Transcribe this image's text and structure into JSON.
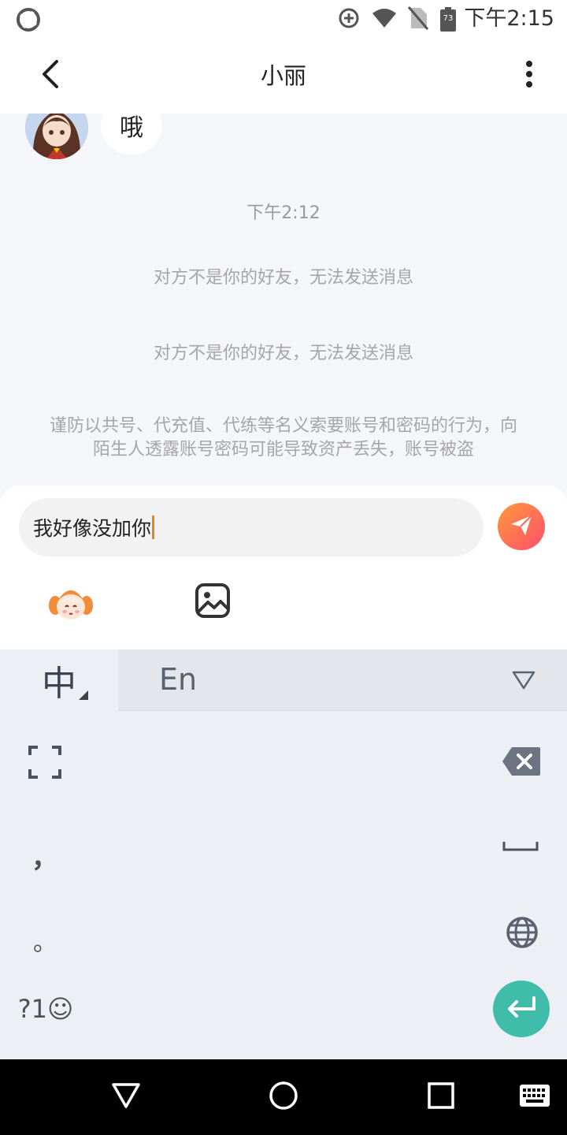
{
  "status_bar": {
    "time": "下午2:15",
    "battery": "73",
    "icons": [
      "app-logo-icon",
      "data-saver-icon",
      "wifi-icon",
      "no-sim-icon",
      "battery-icon"
    ]
  },
  "header": {
    "title": "小丽",
    "back_icon": "chevron-left-icon",
    "more_icon": "more-vertical-icon"
  },
  "chat": {
    "messages": [
      {
        "sender": "小丽",
        "text": "哦"
      }
    ],
    "time_label": "下午2:12",
    "system_notes": [
      "对方不是你的好友，无法发送消息",
      "对方不是你的好友，无法发送消息"
    ],
    "warning": "谨防以共号、代充值、代练等名义索要账号和密码的行为，向陌生人透露账号密码可能导致资产丢失，账号被盗"
  },
  "composer": {
    "input_value": "我好像没加你",
    "send_icon": "paper-plane-icon",
    "tools": [
      "emoji-sticker-icon",
      "image-icon"
    ]
  },
  "keyboard": {
    "lang_zh": "中",
    "lang_en": "En",
    "comma": "，",
    "period": "。",
    "symbols": "?1☺",
    "icons": [
      "expand-icon",
      "backspace-icon",
      "space-icon",
      "globe-icon",
      "enter-icon",
      "collapse-icon"
    ],
    "enter_color": "#3fbdaa"
  },
  "nav_bar": {
    "icons": [
      "nav-back-icon",
      "nav-home-icon",
      "nav-recent-icon",
      "keyboard-switch-icon"
    ]
  },
  "colors": {
    "accent_gradient_start": "#ff9a3c",
    "accent_gradient_end": "#ff4e6a",
    "caret": "#f08020"
  }
}
